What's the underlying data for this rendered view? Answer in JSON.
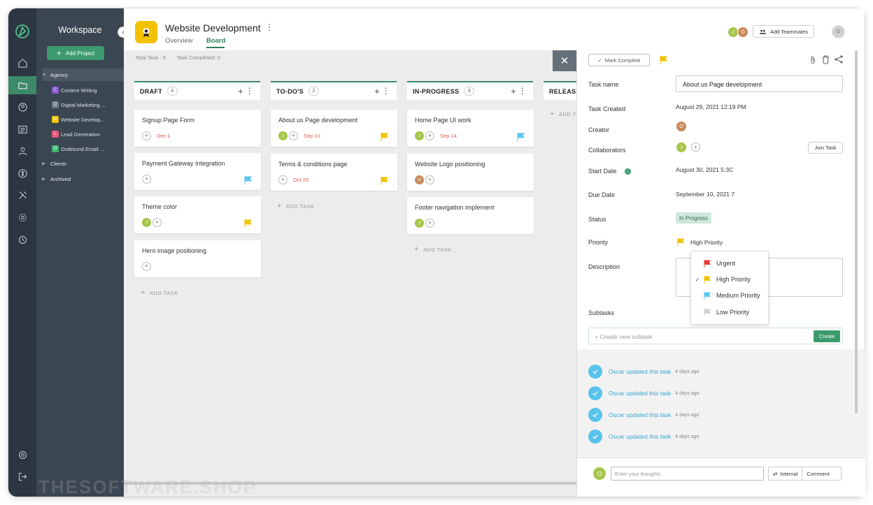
{
  "workspace": {
    "title": "Workspace",
    "add_project_label": "Add Project",
    "groups": [
      "Agency",
      "Clients",
      "Archived"
    ],
    "projects": [
      {
        "label": "Content Writing",
        "letter": "C",
        "color": "#8a5cd6"
      },
      {
        "label": "Digital Marketing ...",
        "letter": "D",
        "color": "#6e7f8d"
      },
      {
        "label": "Website Develop...",
        "letter": "W",
        "color": "#f2c200"
      },
      {
        "label": "Lead Generation",
        "letter": "L",
        "color": "#e9557a"
      },
      {
        "label": "Outbound Email ...",
        "letter": "O",
        "color": "#3dba6f"
      }
    ]
  },
  "header": {
    "project_title": "Website Development",
    "tabs": [
      "Overview",
      "Board"
    ],
    "active_tab": "Board",
    "add_teammates_label": "Add Teammates",
    "avatars": [
      {
        "letter": "J",
        "color": "#a7c54b"
      },
      {
        "letter": "O",
        "color": "#c98a5b"
      }
    ],
    "user_avatar": "O"
  },
  "board": {
    "total_task": "Total Task : 9",
    "task_completed": "Task Completed: 0",
    "add_task_label": "ADD TASK",
    "columns": [
      {
        "name": "DRAFT",
        "count": "4"
      },
      {
        "name": "TO-DO'S",
        "count": "2"
      },
      {
        "name": "IN-PROGRESS",
        "count": "3"
      },
      {
        "name": "RELEASE",
        "count": ""
      }
    ],
    "cards": {
      "draft": [
        {
          "title": "Signup Page Form",
          "date": "Dec 1",
          "flag": ""
        },
        {
          "title": "Payment Gateway Integration",
          "date": "",
          "flag": "#5bc6f0"
        },
        {
          "title": "Theme color",
          "date": "",
          "flag": "#f2c200"
        },
        {
          "title": "Hero image positioning",
          "date": "",
          "flag": ""
        }
      ],
      "todo": [
        {
          "title": "About us Page development",
          "date": "Sep 10",
          "flag": "#f2c200"
        },
        {
          "title": "Terms & conditions page",
          "date": "Oct 29",
          "flag": "#f2c200"
        }
      ],
      "inprogress": [
        {
          "title": "Home Page UI work",
          "date": "Sep 14",
          "flag": "#5bc6f0"
        },
        {
          "title": "Website Logo positioning",
          "date": "",
          "flag": ""
        },
        {
          "title": "Footer navigation implement",
          "date": "",
          "flag": ""
        }
      ]
    }
  },
  "panel": {
    "mark_complete_label": "Mark Complete",
    "fields": {
      "task_name_label": "Task name",
      "task_name_value": "About us Page development",
      "task_created_label": "Task Created",
      "task_created_value": "August 29, 2021 12:19 PM",
      "creator_label": "Creator",
      "collaborators_label": "Collaborators",
      "join_task_label": "Join Task",
      "start_date_label": "Start Date",
      "start_date_value": "August 30, 2021 5:3C",
      "due_date_label": "Due Date",
      "due_date_value": "September 10, 2021 7",
      "status_label": "Status",
      "status_value": "In Progress",
      "priority_label": "Priority",
      "priority_value": "High Priority",
      "description_label": "Description",
      "subtasks_label": "Subtasks",
      "subtask_placeholder": "+ Create new subtask",
      "create_label": "Create"
    },
    "activity": [
      {
        "text": "Oscar updated this task",
        "ago": "4 days ago"
      },
      {
        "text": "Oscar updated this task",
        "ago": "4 days ago"
      },
      {
        "text": "Oscar updated this task",
        "ago": "4 days ago"
      },
      {
        "text": "Oscar updated this task",
        "ago": "4 days ago"
      }
    ],
    "comment_placeholder": "Enter your thoughts",
    "internal_label": "Internal",
    "comment_label": "Comment",
    "commenter_avatar": "O"
  },
  "priority_dropdown": {
    "options": [
      {
        "label": "Urgent",
        "color": "#e53935",
        "checked": false
      },
      {
        "label": "High Priority",
        "color": "#f2c200",
        "checked": true
      },
      {
        "label": "Medium Priority",
        "color": "#5bc6f0",
        "checked": false
      },
      {
        "label": "Low Priority",
        "color": "#cfcfcf",
        "checked": false
      }
    ]
  },
  "watermark": "THESOFTWARE.SHOP",
  "colors": {
    "accent": "#3d9a6f",
    "rail": "#2b3640",
    "sidebar": "#3a4651"
  }
}
